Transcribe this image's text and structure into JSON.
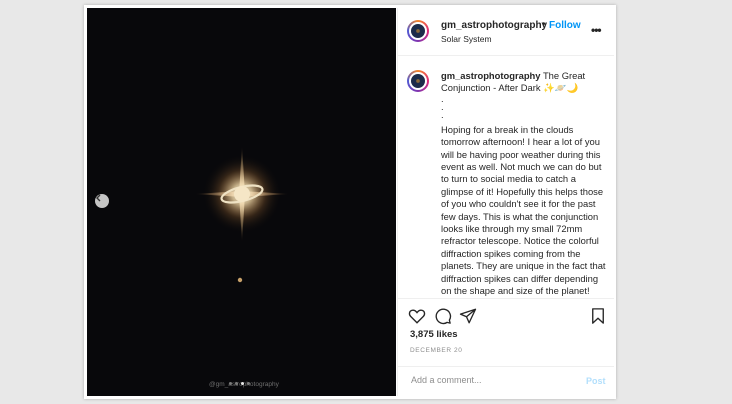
{
  "post": {
    "username": "gm_astrophotography",
    "follow_label": "Follow",
    "separator": "•",
    "location": "Solar System",
    "more_icon": "•••",
    "caption_title": "The Great Conjunction - After Dark",
    "caption_emoji": "✨🪐🌙",
    "caption_dots": [
      ".",
      ".",
      "."
    ],
    "caption_body": "Hoping for a break in the clouds tomorrow afternoon! I hear a lot of you will be having poor weather during this event as well. Not much we can do but to turn to social media to catch a glimpse of it! Hopefully this helps those of you who couldn't see it for the past few days. This is what the conjunction looks like through my small 72mm refractor telescope. Notice the colorful diffraction spikes coming from the planets. They are unique in the fact that diffraction spikes can differ depending on the shape and size of the planet!",
    "likes": "3,875 likes",
    "date": "DECEMBER 20",
    "comment_placeholder": "Add a comment...",
    "post_label": "Post"
  },
  "photo": {
    "watermark": "@gm_astrophotography",
    "carousel_count": 4,
    "carousel_active": 2
  },
  "colors": {
    "accent": "#0095f6",
    "post_disabled": "#b2dffc",
    "photo_bg": "#08080b"
  }
}
